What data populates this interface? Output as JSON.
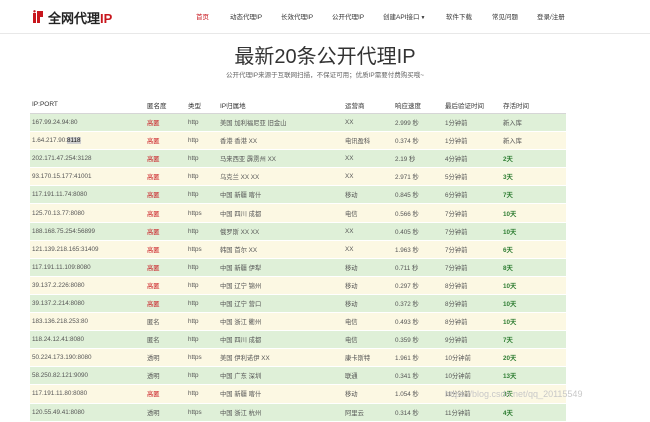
{
  "brand": {
    "name_main": "全网代理",
    "name_suffix": "IP",
    "accent": "#c8161d"
  },
  "nav": [
    {
      "label": "首页",
      "active": true
    },
    {
      "label": "动态代理IP"
    },
    {
      "label": "长效代理IP"
    },
    {
      "label": "公开代理IP"
    },
    {
      "label": "创建API接口",
      "dropdown": true
    },
    {
      "label": "软件下载"
    },
    {
      "label": "常见问题"
    },
    {
      "label": "登录/注册"
    }
  ],
  "page": {
    "title": "最新20条公开代理IP",
    "subtitle": "公开代理IP来源于互联网扫描，不保证可用；优质IP需要付费购买哦~"
  },
  "table": {
    "headers": [
      "IP:PORT",
      "匿名度",
      "类型",
      "IP归属地",
      "运营商",
      "响应速度",
      "最后验证时间",
      "存活时间"
    ],
    "rows": [
      {
        "ip": "167.99.24.94:80",
        "anon": "高匿",
        "type": "http",
        "loc": "美国  加利福尼亚  旧金山",
        "isp": "XX",
        "speed": "2.999 秒",
        "last": "1分钟前",
        "alive": "新入库"
      },
      {
        "ip": "1.64.217.90:",
        "ip_sel": "8118",
        "anon": "高匿",
        "type": "http",
        "loc": "香港  香港  XX",
        "isp": "电讯盈科",
        "speed": "0.374 秒",
        "last": "1分钟前",
        "alive": "新入库"
      },
      {
        "ip": "202.171.47.254:3128",
        "anon": "高匿",
        "type": "http",
        "loc": "马来西亚  霹雳州  XX",
        "isp": "XX",
        "speed": "2.19 秒",
        "last": "4分钟前",
        "alive": "2天"
      },
      {
        "ip": "93.170.15.177:41001",
        "anon": "高匿",
        "type": "http",
        "loc": "乌克兰  XX  XX",
        "isp": "XX",
        "speed": "2.971 秒",
        "last": "5分钟前",
        "alive": "3天"
      },
      {
        "ip": "117.191.11.74:8080",
        "anon": "高匿",
        "type": "http",
        "loc": "中国  新疆  喀什",
        "isp": "移动",
        "speed": "0.845 秒",
        "last": "6分钟前",
        "alive": "7天"
      },
      {
        "ip": "125.70.13.77:8080",
        "anon": "高匿",
        "type": "https",
        "loc": "中国  四川  成都",
        "isp": "电信",
        "speed": "0.566 秒",
        "last": "7分钟前",
        "alive": "10天"
      },
      {
        "ip": "188.168.75.254:56899",
        "anon": "高匿",
        "type": "http",
        "loc": "俄罗斯  XX  XX",
        "isp": "XX",
        "speed": "0.405 秒",
        "last": "7分钟前",
        "alive": "10天"
      },
      {
        "ip": "121.139.218.165:31409",
        "anon": "高匿",
        "type": "https",
        "loc": "韩国  首尔  XX",
        "isp": "XX",
        "speed": "1.963 秒",
        "last": "7分钟前",
        "alive": "6天"
      },
      {
        "ip": "117.191.11.109:8080",
        "anon": "高匿",
        "type": "http",
        "loc": "中国  新疆  伊犁",
        "isp": "移动",
        "speed": "0.711 秒",
        "last": "7分钟前",
        "alive": "8天"
      },
      {
        "ip": "39.137.2.226:8080",
        "anon": "高匿",
        "type": "http",
        "loc": "中国  辽宁  锦州",
        "isp": "移动",
        "speed": "0.297 秒",
        "last": "8分钟前",
        "alive": "10天"
      },
      {
        "ip": "39.137.2.214:8080",
        "anon": "高匿",
        "type": "http",
        "loc": "中国  辽宁  营口",
        "isp": "移动",
        "speed": "0.372 秒",
        "last": "8分钟前",
        "alive": "10天"
      },
      {
        "ip": "183.136.218.253:80",
        "anon": "匿名",
        "type": "http",
        "loc": "中国  浙江  衢州",
        "isp": "电信",
        "speed": "0.493 秒",
        "last": "8分钟前",
        "alive": "10天"
      },
      {
        "ip": "118.24.12.41:8080",
        "anon": "匿名",
        "type": "http",
        "loc": "中国  四川  成都",
        "isp": "电信",
        "speed": "0.359 秒",
        "last": "9分钟前",
        "alive": "7天"
      },
      {
        "ip": "50.224.173.190:8080",
        "anon": "透明",
        "type": "https",
        "loc": "美国  伊利诺伊  XX",
        "isp": "康卡斯特",
        "speed": "1.961 秒",
        "last": "10分钟前",
        "alive": "20天"
      },
      {
        "ip": "58.250.82.121:9090",
        "anon": "透明",
        "type": "http",
        "loc": "中国  广东  深圳",
        "isp": "联通",
        "speed": "0.341 秒",
        "last": "10分钟前",
        "alive": "13天"
      },
      {
        "ip": "117.191.11.80:8080",
        "anon": "高匿",
        "type": "http",
        "loc": "中国  新疆  喀什",
        "isp": "移动",
        "speed": "1.054 秒",
        "last": "11分钟前",
        "alive": "3天"
      },
      {
        "ip": "120.55.49.41:8080",
        "anon": "透明",
        "type": "https",
        "loc": "中国  浙江  杭州",
        "isp": "阿里云",
        "speed": "0.314 秒",
        "last": "11分钟前",
        "alive": "4天"
      }
    ]
  },
  "watermark": "https://blog.csdn.net/qq_20115549"
}
